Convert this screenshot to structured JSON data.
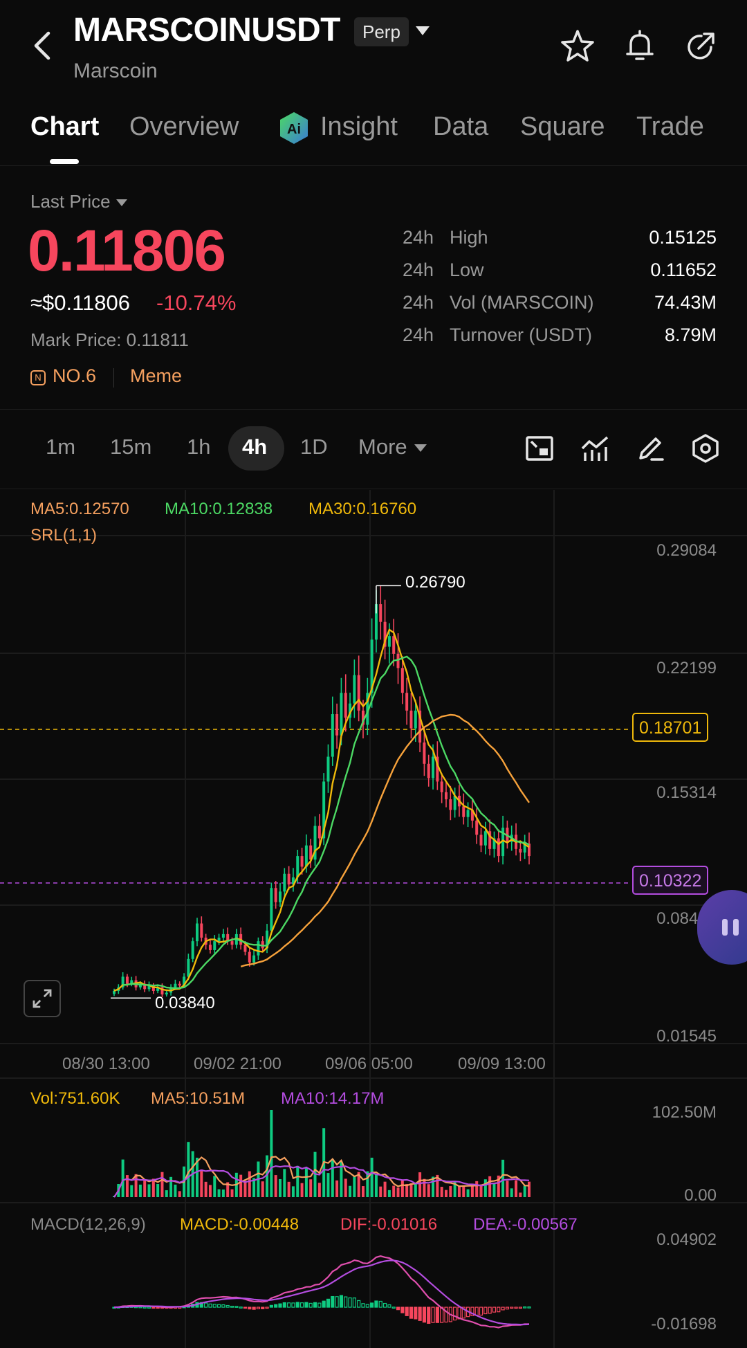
{
  "header": {
    "symbol": "MARSCOINUSDT",
    "badge": "Perp",
    "subname": "Marscoin"
  },
  "tabs": [
    {
      "label": "Chart",
      "active": true
    },
    {
      "label": "Overview"
    },
    {
      "label": "Insight",
      "icon": "ai-insight-icon"
    },
    {
      "label": "Data"
    },
    {
      "label": "Square"
    },
    {
      "label": "Trade"
    }
  ],
  "price": {
    "label": "Last Price",
    "last": "0.11806",
    "usd": "≈$0.11806",
    "change": "-10.74%",
    "mark": "Mark Price: 0.11811",
    "rank": "NO.6",
    "tag": "Meme"
  },
  "stats": [
    {
      "period": "24h",
      "label": "High",
      "value": "0.15125"
    },
    {
      "period": "24h",
      "label": "Low",
      "value": "0.11652"
    },
    {
      "period": "24h",
      "label": "Vol (MARSCOIN)",
      "value": "74.43M"
    },
    {
      "period": "24h",
      "label": "Turnover (USDT)",
      "value": "8.79M"
    }
  ],
  "intervals": [
    "1m",
    "15m",
    "1h",
    "4h",
    "1D",
    "More"
  ],
  "active_interval": "4h",
  "indicators": {
    "ma5": "MA5:0.12570",
    "ma10": "MA10:0.12838",
    "ma30": "MA30:0.16760",
    "srl": "SRL(1,1)",
    "vol": "Vol:751.60K",
    "vol_ma5": "MA5:10.51M",
    "vol_ma10": "MA10:14.17M",
    "macd_title": "MACD(12,26,9)",
    "macd": "MACD:-0.00448",
    "dif": "DIF:-0.01016",
    "dea": "DEA:-0.00567"
  },
  "price_axis": [
    "0.29084",
    "0.22199",
    "0.15314",
    "0.08429",
    "0.01545"
  ],
  "time_axis": [
    "08/30 13:00",
    "09/02 21:00",
    "09/06 05:00",
    "09/09 13:00"
  ],
  "tags": {
    "resistance": "0.18701",
    "support": "0.10322",
    "high_marker": "0.26790",
    "low_marker": "0.03840"
  },
  "vol_axis": [
    "102.50M",
    "0.00"
  ],
  "macd_axis": [
    "0.04902",
    "-0.01698"
  ],
  "colors": {
    "up": "#0ecb81",
    "down": "#f6465d",
    "ma5": "#f0b90b",
    "ma10": "#4cd964",
    "ma30": "#f7a23b",
    "purple": "#b44de0",
    "orange": "#f5a05f"
  },
  "chart_data": {
    "type": "candlestick",
    "time_labels": [
      "08/30 13:00",
      "09/02 21:00",
      "09/06 05:00",
      "09/09 13:00"
    ],
    "y_range": [
      0.01545,
      0.29084
    ],
    "close": [
      0.042,
      0.044,
      0.05,
      0.046,
      0.048,
      0.044,
      0.046,
      0.043,
      0.045,
      0.042,
      0.044,
      0.04,
      0.041,
      0.044,
      0.046,
      0.045,
      0.05,
      0.06,
      0.07,
      0.08,
      0.072,
      0.068,
      0.065,
      0.07,
      0.072,
      0.074,
      0.07,
      0.068,
      0.074,
      0.068,
      0.064,
      0.058,
      0.062,
      0.07,
      0.066,
      0.076,
      0.1,
      0.092,
      0.098,
      0.108,
      0.102,
      0.106,
      0.118,
      0.112,
      0.124,
      0.116,
      0.135,
      0.128,
      0.16,
      0.174,
      0.198,
      0.186,
      0.21,
      0.196,
      0.204,
      0.22,
      0.2,
      0.192,
      0.21,
      0.24,
      0.26,
      0.25,
      0.236,
      0.242,
      0.232,
      0.224,
      0.21,
      0.2,
      0.19,
      0.2,
      0.182,
      0.17,
      0.162,
      0.174,
      0.16,
      0.154,
      0.15,
      0.144,
      0.152,
      0.146,
      0.14,
      0.144,
      0.138,
      0.13,
      0.124,
      0.132,
      0.122,
      0.128,
      0.118,
      0.134,
      0.126,
      0.13,
      0.122,
      0.12,
      0.125,
      0.118
    ],
    "volume_max": "102.50M",
    "macd_range": [
      -0.01698,
      0.04902
    ]
  }
}
